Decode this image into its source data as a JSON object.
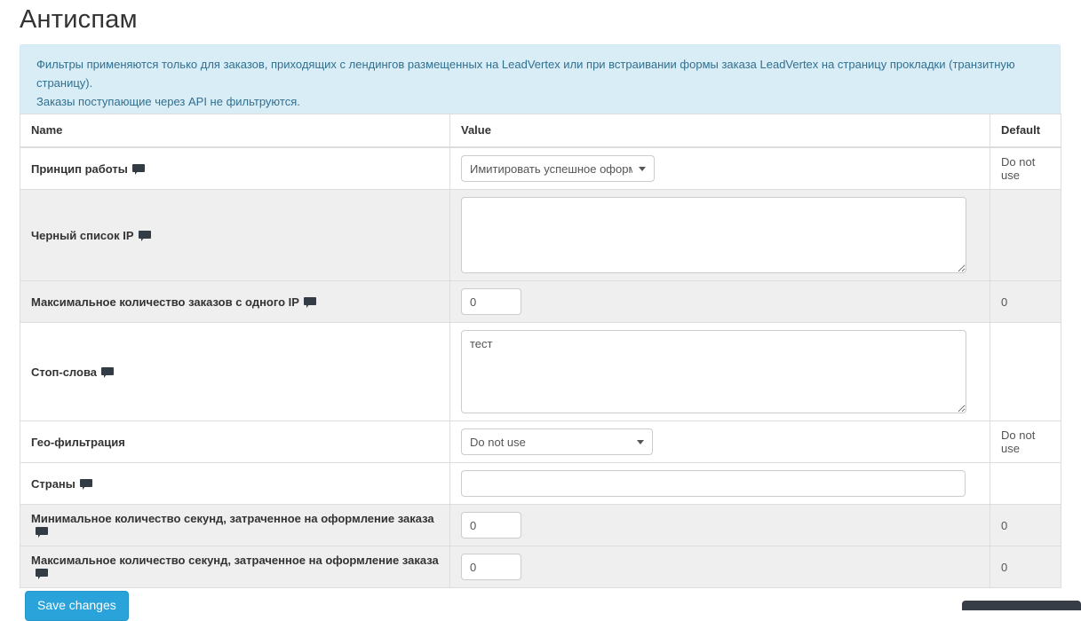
{
  "page": {
    "title": "Антиспам"
  },
  "alert": {
    "line1": "Фильтры применяются только для заказов, приходящих с лендингов размещенных на LeadVertex или при встраивании формы заказа LeadVertex на страницу прокладки (транзитную страницу).",
    "line2": "Заказы поступающие через API не фильтруются."
  },
  "table": {
    "headers": {
      "name": "Name",
      "value": "Value",
      "default": "Default"
    },
    "rows": [
      {
        "name": "Принцип работы",
        "has_comment_icon": true,
        "control": "select",
        "value": "Имитировать успешное оформле",
        "options": [
          "Do not use",
          "Имитировать успешное оформление"
        ],
        "default": "Do not use",
        "striped": false
      },
      {
        "name": "Черный список IP",
        "has_comment_icon": true,
        "control": "textarea",
        "value": "",
        "default": "",
        "striped": true
      },
      {
        "name": "Максимальное количество заказов с одного IP",
        "has_comment_icon": true,
        "control": "input-small",
        "value": "0",
        "default": "0",
        "striped": true
      },
      {
        "name": "Стоп-слова",
        "has_comment_icon": true,
        "control": "textarea",
        "value": "тест",
        "default": "",
        "striped": false
      },
      {
        "name": "Гео-фильтрация",
        "has_comment_icon": false,
        "control": "select",
        "value": "Do not use",
        "options": [
          "Do not use"
        ],
        "default": "Do not use",
        "striped": false
      },
      {
        "name": "Страны",
        "has_comment_icon": true,
        "control": "input-wide",
        "value": "",
        "default": "",
        "striped": false
      },
      {
        "name": "Минимальное количество секунд, затраченное на оформление заказа",
        "has_comment_icon": true,
        "control": "input-small",
        "value": "0",
        "default": "0",
        "striped": true
      },
      {
        "name": "Максимальное количество секунд, затраченное на оформление заказа",
        "has_comment_icon": true,
        "control": "input-small",
        "value": "0",
        "default": "0",
        "striped": true
      }
    ]
  },
  "footer": {
    "save_label": "Save changes"
  },
  "colors": {
    "accent": "#2aa3da",
    "alert_bg": "#d9edf7",
    "alert_text": "#31708f",
    "stripe": "#efefef",
    "border": "#dddddd",
    "chat_widget": "#363d47"
  }
}
